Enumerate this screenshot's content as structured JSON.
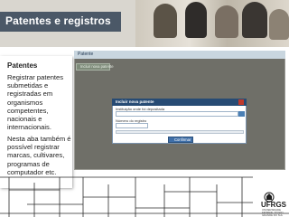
{
  "header": {
    "title": "Patentes e registros"
  },
  "sidebar": {
    "heading": "Patentes",
    "paragraph1": "Registrar patentes submetidas e registradas em organismos competentes, nacionais e internacionais.",
    "paragraph2": "Nesta aba também é possível registrar marcas, cultivares, programas de computador etc."
  },
  "app": {
    "window_title": "Patente",
    "toolbar_button": "Incluir nova patente",
    "dialog": {
      "title": "Incluir nova patente",
      "field1_label": "Instituição onde foi depositada",
      "field2_label": "Número do registro",
      "confirm_button": "Confirmar"
    }
  },
  "footer": {
    "logo": "UFRGS",
    "logo_sub": "UNIVERSIDADE FEDERAL DO RIO GRANDE DO SUL"
  },
  "colors": {
    "title_bar": "#4b5867",
    "dialog_title": "#274b74",
    "confirm": "#3f6fa8"
  }
}
